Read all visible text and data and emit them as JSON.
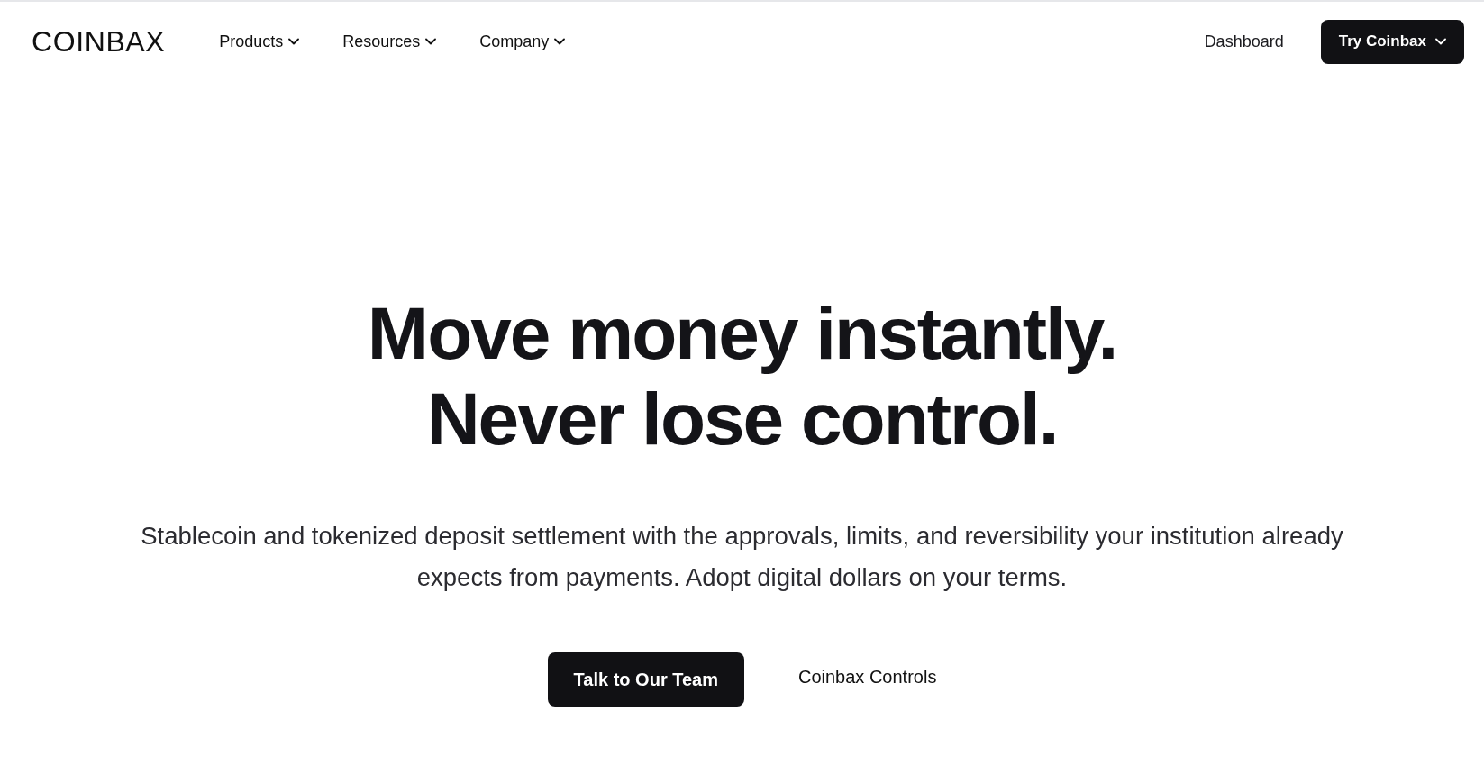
{
  "nav": {
    "logo": "COINBAX",
    "menu": [
      {
        "label": "Products"
      },
      {
        "label": "Resources"
      },
      {
        "label": "Company"
      }
    ],
    "dashboard_link": "Dashboard",
    "cta": "Try Coinbax"
  },
  "hero": {
    "headline": [
      "Move money instantly.",
      "Never lose control."
    ],
    "subtitle": "Stablecoin and tokenized deposit settlement with the approvals, limits, and reversibility your institution already expects from payments. Adopt digital dollars on your terms.",
    "primary_button": "Talk to Our Team",
    "secondary_link": "Coinbax Controls"
  }
}
